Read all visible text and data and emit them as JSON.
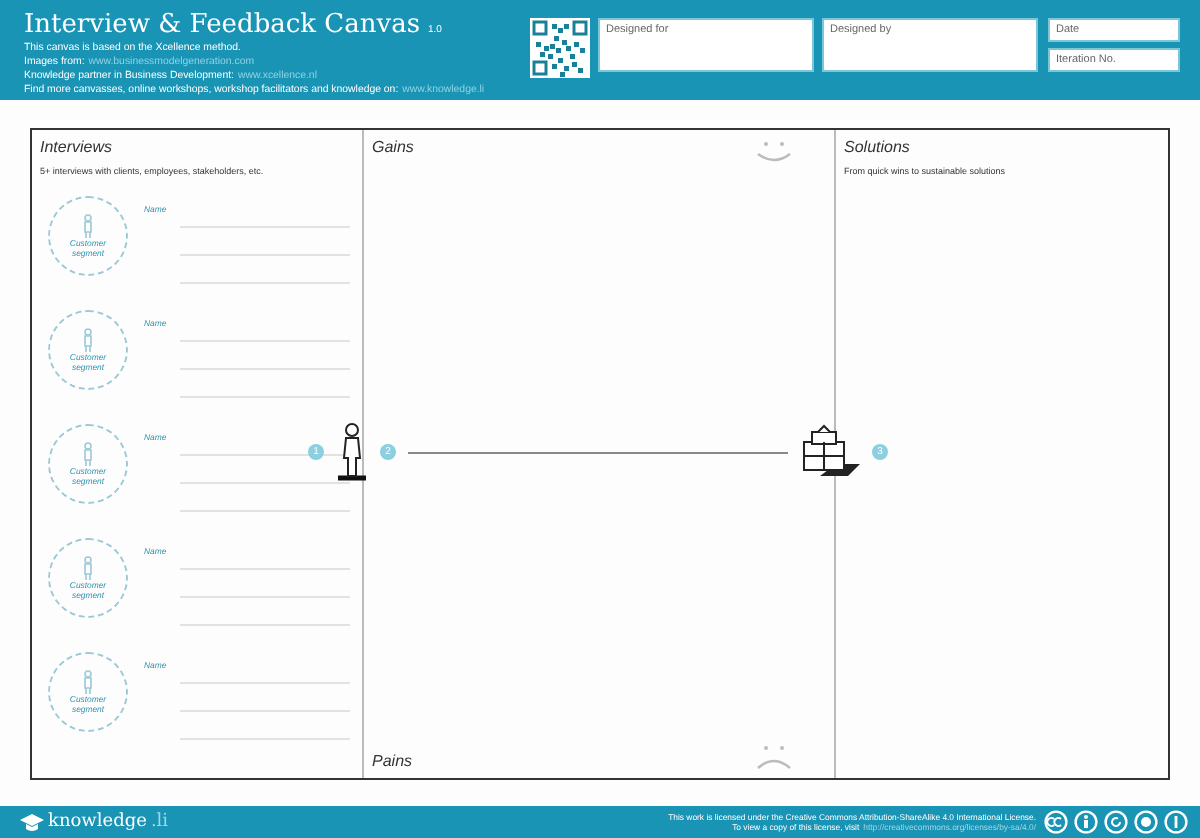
{
  "header": {
    "title": "Interview & Feedback Canvas",
    "version": "1.0",
    "lines": [
      {
        "text": "This canvas is based on the Xcellence method."
      },
      {
        "text": "Images from:",
        "link": "www.businessmodelgeneration.com"
      },
      {
        "text": "Knowledge partner in Business Development:",
        "link": "www.xcellence.nl"
      },
      {
        "text": "Find more canvasses, online workshops, workshop facilitators and knowledge on:",
        "link": "www.knowledge.li"
      }
    ]
  },
  "fields": [
    {
      "label": "Designed for",
      "kind": "large"
    },
    {
      "label": "Designed by",
      "kind": "large"
    },
    {
      "label": "Date",
      "kind": "small"
    },
    {
      "label": "Iteration No.",
      "kind": "small"
    }
  ],
  "canvas": {
    "interviews": {
      "title": "Interviews",
      "description": "5+ interviews with clients, employees, stakeholders, etc.",
      "entries": [
        {
          "segment": "Customer segment",
          "name_label": "Name"
        },
        {
          "segment": "Customer segment",
          "name_label": "Name"
        },
        {
          "segment": "Customer segment",
          "name_label": "Name"
        },
        {
          "segment": "Customer segment",
          "name_label": "Name"
        },
        {
          "segment": "Customer segment",
          "name_label": "Name"
        }
      ]
    },
    "gains": {
      "title": "Gains"
    },
    "pains": {
      "title": "Pains"
    },
    "solutions": {
      "title": "Solutions",
      "description": "From quick wins to sustainable solutions"
    },
    "steps": [
      "1",
      "2",
      "3"
    ]
  },
  "footer": {
    "logo": {
      "name": "knowledge",
      "tld": ".li"
    },
    "license_lines": [
      "This work is licensed under the Creative Commons Attribution-ShareAlike 4.0 International License."
    ],
    "license_visit": "To view a copy of this license, visit",
    "license_link": "http://creativecommons.org/licenses/by-sa/4.0/"
  }
}
